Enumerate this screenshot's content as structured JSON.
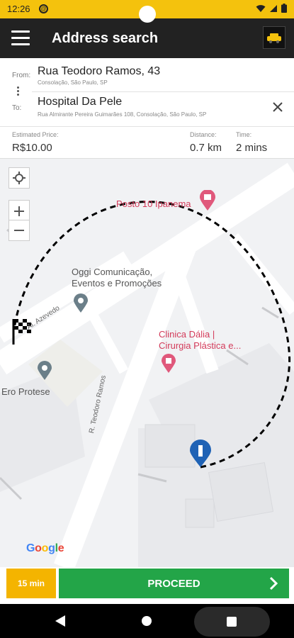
{
  "status_bar": {
    "time": "12:26",
    "app_icon_glyph": "@"
  },
  "app_bar": {
    "title": "Address search",
    "menu_icon": "hamburger-menu-icon",
    "logo_icon": "taxi-app-logo"
  },
  "route": {
    "from_label": "From:",
    "from_name": "Rua Teodoro Ramos, 43",
    "from_sub": "Consolação, São Paulo, SP",
    "to_label": "To:",
    "to_name": "Hospital Da Pele",
    "to_sub": "Rua Almirante Pereira Guimarães 108, Consolação, São Paulo, SP"
  },
  "estimate": {
    "price_label": "Estimated Price:",
    "price_value": "R$10.00",
    "distance_label": "Distance:",
    "distance_value": "0.7 km",
    "time_label": "Time:",
    "time_value": "2 mins"
  },
  "map": {
    "pois": {
      "posto": "Posto 10 Ipanema",
      "oggi_1": "Oggi Comunicação,",
      "oggi_2": "Eventos e Promoções",
      "clinica_1": "Clinica Dália |",
      "clinica_2": "Cirurgia Plástica e...",
      "ero": "Ero Protese"
    },
    "streets": {
      "teodoro": "R. Teodoro Ramos",
      "azevedo": "Al. Azevedo"
    },
    "attribution": [
      "G",
      "o",
      "o",
      "g",
      "l",
      "e"
    ],
    "colors": {
      "poi_red": "#d33b5a",
      "route_dash": "#000000",
      "pin_blue": "#1f62b5"
    }
  },
  "bottom": {
    "eta": "15 min",
    "proceed_label": "PROCEED"
  },
  "colors": {
    "accent_yellow": "#f4c20d",
    "eta_orange": "#f4b400",
    "proceed_green": "#23a548",
    "app_bar": "#222222"
  }
}
